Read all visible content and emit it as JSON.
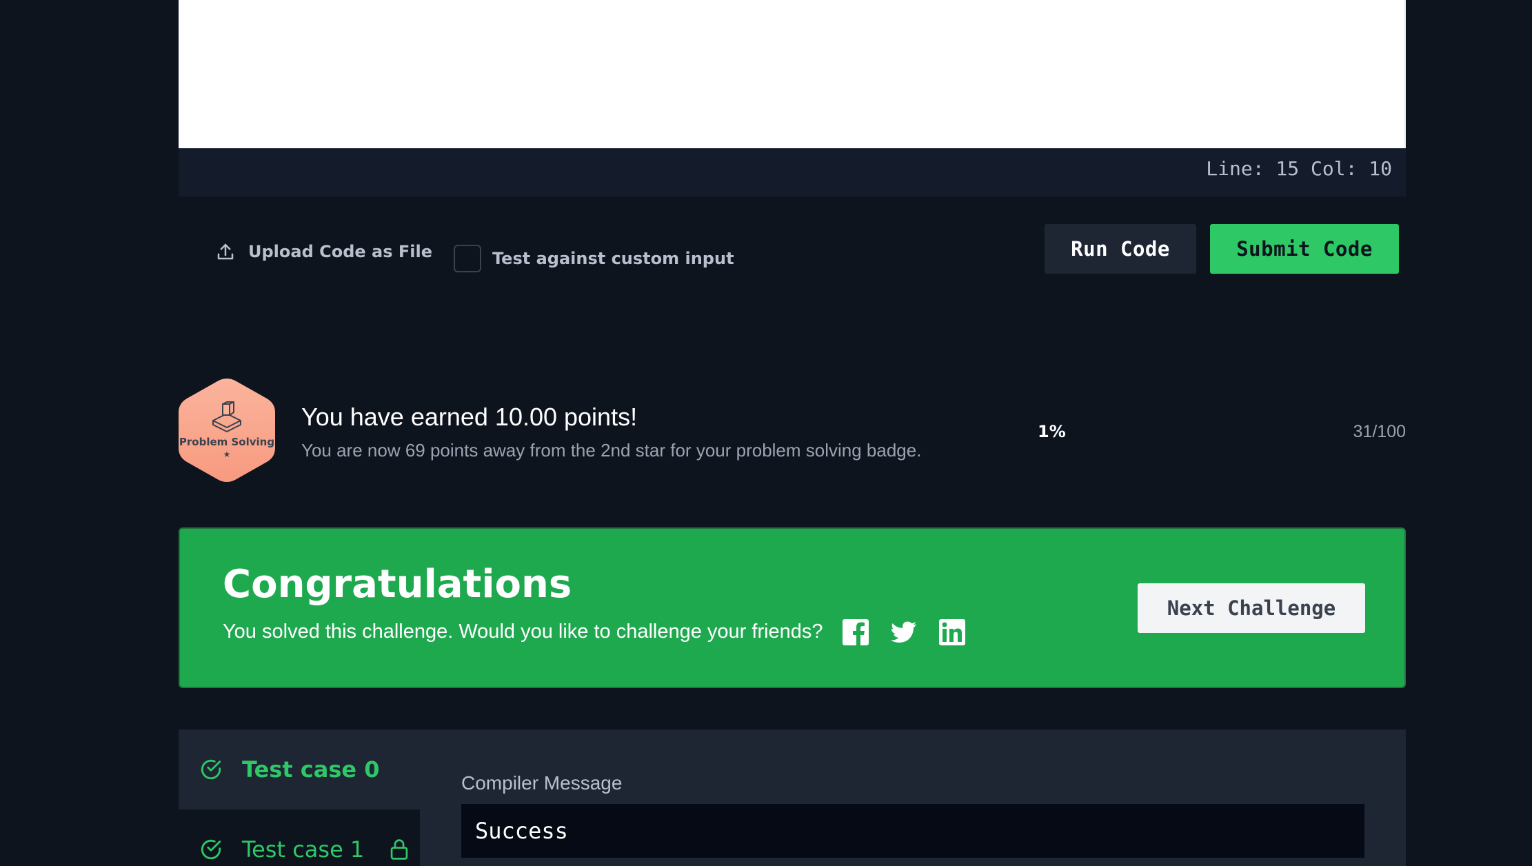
{
  "editor": {
    "status": "Line: 15 Col: 10"
  },
  "toolbar": {
    "upload_label": "Upload Code as File",
    "custom_input_label": "Test against custom input",
    "run_label": "Run Code",
    "submit_label": "Submit Code"
  },
  "points": {
    "badge_name": "Problem Solving",
    "badge_stars": "★",
    "title": "You have earned 10.00 points!",
    "subtitle": "You are now 69 points away from the 2nd star for your problem solving badge.",
    "percent": "1%",
    "progress": "31/100"
  },
  "congrats": {
    "title": "Congratulations",
    "message": "You solved this challenge. Would you like to challenge your friends?",
    "next_label": "Next Challenge",
    "share_icons": [
      "facebook-icon",
      "twitter-icon",
      "linkedin-icon"
    ]
  },
  "results": {
    "tests": [
      {
        "label": "Test case 0",
        "status": "passed",
        "locked": false
      },
      {
        "label": "Test case 1",
        "status": "passed",
        "locked": true
      }
    ],
    "compiler_label": "Compiler Message",
    "compiler_message": "Success"
  },
  "colors": {
    "background": "#0e141e",
    "accent_green": "#2ec866",
    "banner_green": "#1ea94f",
    "badge": "#f9a78e"
  }
}
